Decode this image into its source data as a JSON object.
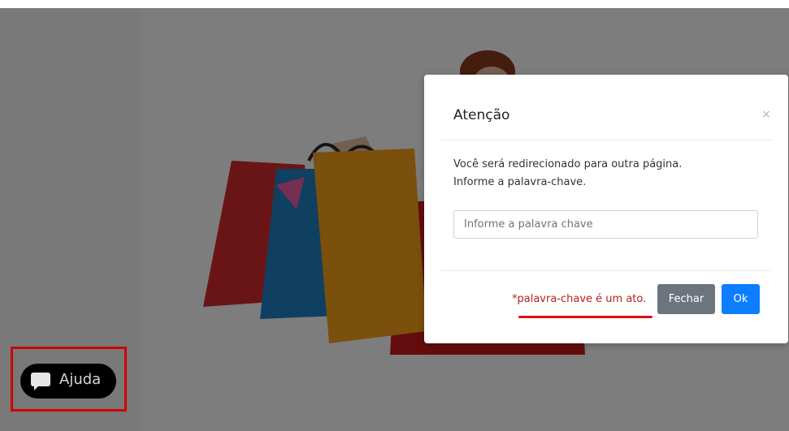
{
  "modal": {
    "title": "Atenção",
    "close_icon": "close-icon",
    "body_line1": "Você será redirecionado para outra página.",
    "body_line2": "Informe a palavra-chave.",
    "input_placeholder": "Informe a palavra chave",
    "input_value": "",
    "note": "*palavra-chave é um ato.",
    "close_button": "Fechar",
    "ok_button": "Ok"
  },
  "help_widget": {
    "label": "Ajuda",
    "icon": "chat-bubble-icon"
  },
  "colors": {
    "primary_button": "#0d7eff",
    "secondary_button": "#6c757d",
    "note_text": "#b22222",
    "highlight": "#e01010"
  }
}
